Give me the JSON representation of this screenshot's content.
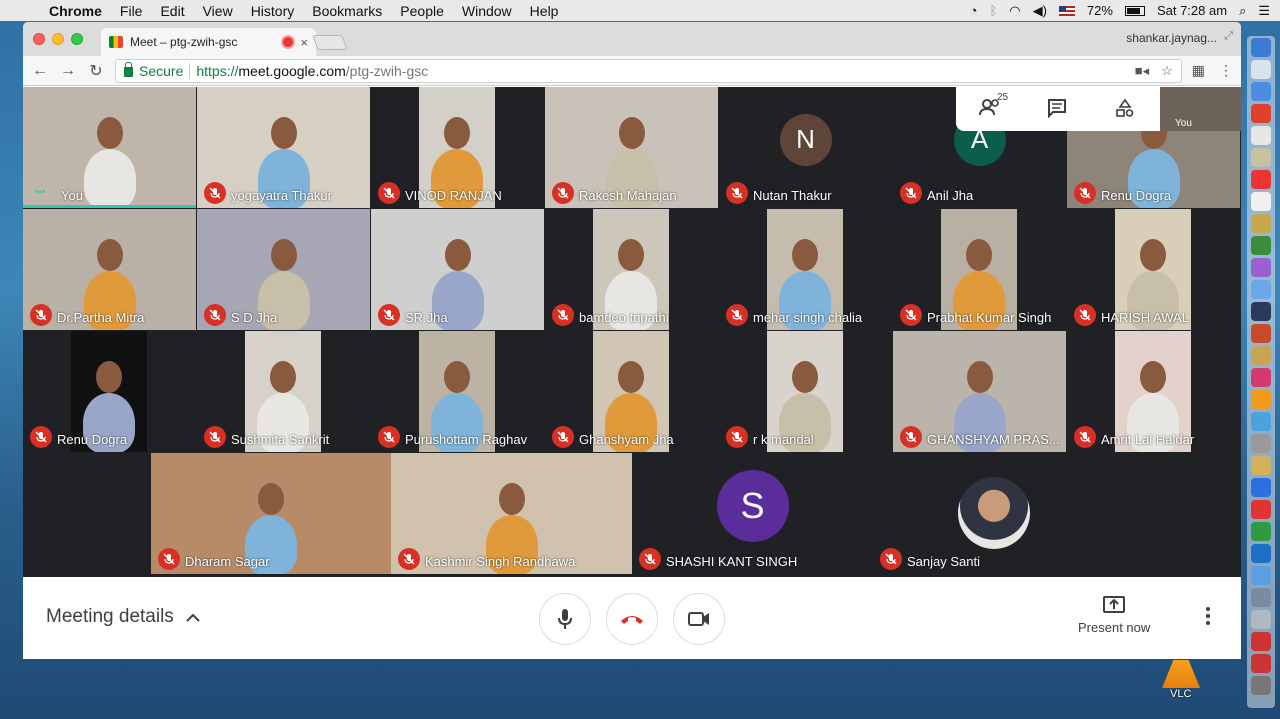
{
  "menubar": {
    "app": "Chrome",
    "items": [
      "File",
      "Edit",
      "View",
      "History",
      "Bookmarks",
      "People",
      "Window",
      "Help"
    ],
    "battery": "72%",
    "clock": "Sat 7:28 am"
  },
  "browser": {
    "tab_title": "Meet – ptg-zwih-gsc",
    "tab_close": "×",
    "profile": "shankar.jaynag...",
    "secure_label": "Secure",
    "url_scheme": "https://",
    "url_host": "meet.google.com",
    "url_path": "/ptg-zwih-gsc"
  },
  "meet": {
    "participant_count": "25",
    "self_label": "You",
    "avatars": {
      "nutan": {
        "letter": "N",
        "color": "#5f4439"
      },
      "anil": {
        "letter": "A",
        "color": "#0b5e4b"
      },
      "shashi": {
        "letter": "S",
        "color": "#5b2d9a"
      }
    },
    "participants": [
      "You",
      "yogayatra Thakur",
      "VINOD RANJAN",
      "Rakesh Mahajan",
      "Nutan Thakur",
      "Anil Jha",
      "Renu Dogra",
      "Dr.Partha Mitra",
      "S D Jha",
      "SR Jha",
      "bamdeo tripathi",
      "mehar singh chalia",
      "Prabhat Kumar Singh",
      "HARISH AWAL",
      "Renu Dogra",
      "Sushmita Sankrit",
      "Purushottam Raghav",
      "Ghanshyam Jha",
      "r k mandal",
      "GHANSHYAM PRAS...",
      "Amrit Lal Haldar",
      "Dharam Sagar",
      "Kashmir Singh Randhawa",
      "SHASHI KANT SINGH",
      "Sanjay Santi"
    ],
    "bottom": {
      "meeting_details": "Meeting details",
      "present_now": "Present now"
    }
  },
  "dock": {
    "vlc_label": "VLC"
  }
}
